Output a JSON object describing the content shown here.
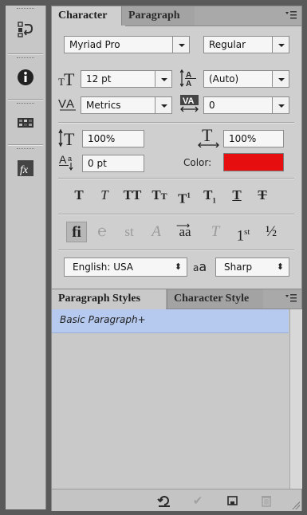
{
  "character_panel": {
    "tabs": [
      "Character",
      "Paragraph"
    ],
    "font_family": "Myriad Pro",
    "font_style": "Regular",
    "font_size": "12 pt",
    "leading": "(Auto)",
    "kerning": "Metrics",
    "tracking": "0",
    "vertical_scale": "100%",
    "horizontal_scale": "100%",
    "baseline_shift": "0 pt",
    "color_label": "Color:",
    "color_value": "#e60e0e",
    "language": "English: USA",
    "antialias_glyph": "a",
    "antialias_glyph_small": "a",
    "antialias": "Sharp",
    "type_style_buttons": [
      {
        "id": "faux-bold",
        "glyph": "T"
      },
      {
        "id": "faux-italic",
        "glyph": "T"
      },
      {
        "id": "all-caps",
        "glyph": "TT"
      },
      {
        "id": "small-caps",
        "glyph": "Tt"
      },
      {
        "id": "superscript",
        "glyph": "T",
        "sup": "1"
      },
      {
        "id": "subscript",
        "glyph": "T",
        "sub": "1"
      },
      {
        "id": "underline",
        "glyph": "T"
      },
      {
        "id": "strikethrough",
        "glyph": "T"
      }
    ],
    "opentype_buttons": [
      {
        "id": "standard-ligatures",
        "glyph": "fi"
      },
      {
        "id": "contextual-alternates",
        "glyph": "℮"
      },
      {
        "id": "discretionary-ligatures",
        "glyph": "st"
      },
      {
        "id": "swash",
        "glyph": "A"
      },
      {
        "id": "stylistic-alternates",
        "glyph": "aa"
      },
      {
        "id": "titling-alternates",
        "glyph": "T"
      },
      {
        "id": "ordinals",
        "glyph": "1",
        "sup": "st"
      },
      {
        "id": "fractions",
        "glyph": "½"
      }
    ]
  },
  "styles_panel": {
    "tabs": [
      "Paragraph Styles",
      "Character Style"
    ],
    "items": [
      "Basic Paragraph+"
    ]
  },
  "strip": {
    "icons": [
      "history-icon",
      "info-icon",
      "swatches-icon",
      "styles-fx-icon"
    ]
  }
}
